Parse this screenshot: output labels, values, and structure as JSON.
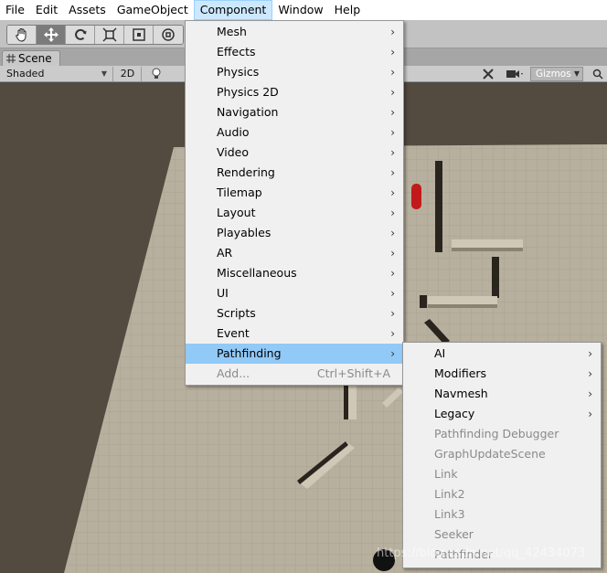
{
  "menubar": {
    "items": [
      "File",
      "Edit",
      "Assets",
      "GameObject",
      "Component",
      "Window",
      "Help"
    ]
  },
  "toolbar": {
    "tools": [
      "hand-tool",
      "move-tool",
      "rotate-tool",
      "scale-tool",
      "rect-tool",
      "transform-tool"
    ]
  },
  "scene_tab": {
    "label": "Scene"
  },
  "scene_toolbar": {
    "shading_mode": "Shaded",
    "mode_2d": "2D",
    "gizmos": "Gizmos"
  },
  "component_menu": {
    "items": [
      {
        "label": "Mesh"
      },
      {
        "label": "Effects"
      },
      {
        "label": "Physics"
      },
      {
        "label": "Physics 2D"
      },
      {
        "label": "Navigation"
      },
      {
        "label": "Audio"
      },
      {
        "label": "Video"
      },
      {
        "label": "Rendering"
      },
      {
        "label": "Tilemap"
      },
      {
        "label": "Layout"
      },
      {
        "label": "Playables"
      },
      {
        "label": "AR"
      },
      {
        "label": "Miscellaneous"
      },
      {
        "label": "UI"
      },
      {
        "label": "Scripts"
      },
      {
        "label": "Event"
      },
      {
        "label": "Pathfinding"
      },
      {
        "label": "Add...",
        "shortcut": "Ctrl+Shift+A"
      }
    ]
  },
  "pathfinding_menu": {
    "items": [
      {
        "label": "AI"
      },
      {
        "label": "Modifiers"
      },
      {
        "label": "Navmesh"
      },
      {
        "label": "Legacy"
      },
      {
        "label": "Pathfinding Debugger"
      },
      {
        "label": "GraphUpdateScene"
      },
      {
        "label": "Link"
      },
      {
        "label": "Link2"
      },
      {
        "label": "Link3"
      },
      {
        "label": "Seeker"
      },
      {
        "label": "Pathfinder"
      }
    ]
  },
  "watermark": "https://blog.csdn.net/qq_42434073",
  "colors": {
    "menu_highlight": "#91c9f7",
    "menubar_open": "#cce8ff",
    "ground": "#b6ae9c",
    "agent": "#c21a1a"
  }
}
